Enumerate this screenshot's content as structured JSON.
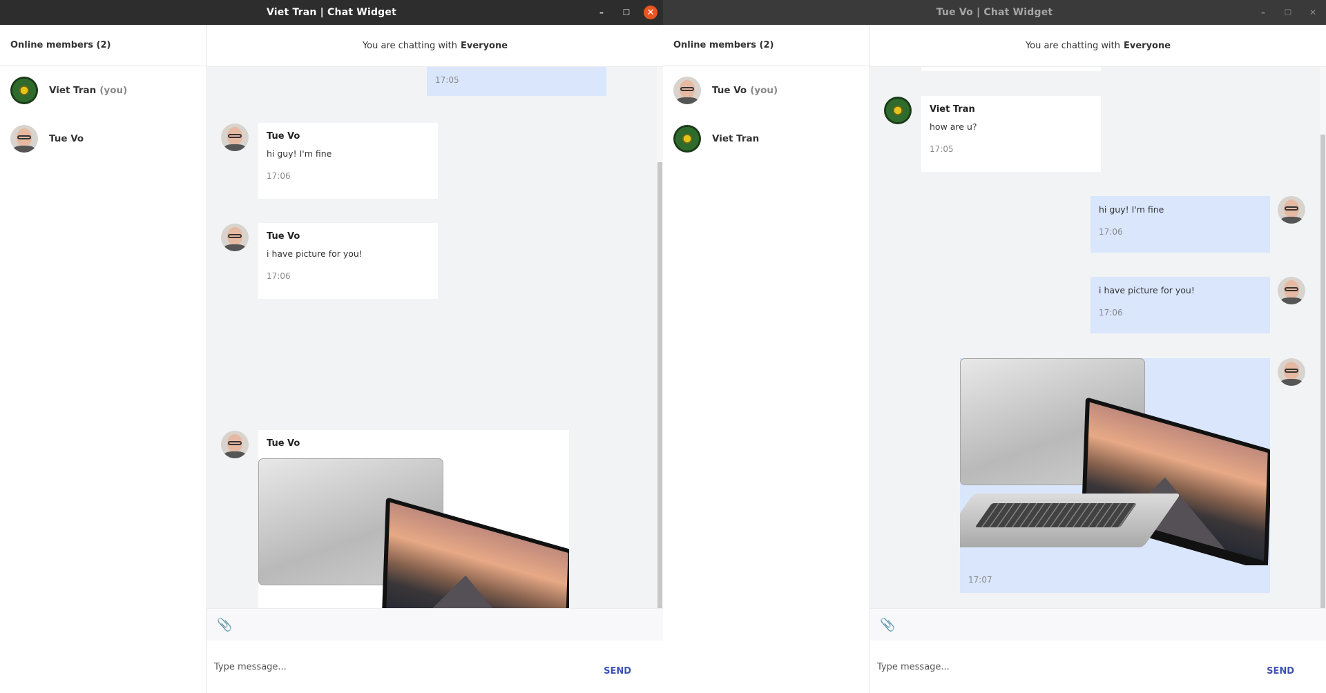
{
  "windows": [
    {
      "title": "Viet Tran | Chat Widget",
      "sidebar": {
        "heading": "Online members (2)",
        "members": [
          {
            "name": "Viet Tran",
            "suffix": "(you)"
          },
          {
            "name": "Tue Vo",
            "suffix": ""
          }
        ]
      },
      "chat": {
        "prefix": "You are chatting with",
        "target": "Everyone",
        "messages": [
          {
            "author": "",
            "text": "",
            "time": "17:05"
          },
          {
            "author": "Tue Vo",
            "text": "hi guy! I'm fine",
            "time": "17:06"
          },
          {
            "author": "Tue Vo",
            "text": "i have picture for you!",
            "time": "17:06"
          },
          {
            "author": "Tue Vo",
            "text": "",
            "time": ""
          }
        ],
        "input_placeholder": "Type message...",
        "send_label": "SEND"
      }
    },
    {
      "title": "Tue Vo | Chat Widget",
      "sidebar": {
        "heading": "Online members (2)",
        "members": [
          {
            "name": "Tue Vo",
            "suffix": "(you)"
          },
          {
            "name": "Viet Tran",
            "suffix": ""
          }
        ]
      },
      "chat": {
        "prefix": "You are chatting with",
        "target": "Everyone",
        "messages": [
          {
            "author": "Viet Tran",
            "text": "how are u?",
            "time": "17:05"
          },
          {
            "author": "",
            "text": "hi guy! I'm fine",
            "time": "17:06"
          },
          {
            "author": "",
            "text": "i have picture for you!",
            "time": "17:06"
          },
          {
            "author": "",
            "text": "",
            "time": "17:07"
          }
        ],
        "input_placeholder": "Type message...",
        "send_label": "SEND"
      }
    }
  ],
  "icons": {
    "minimize": "–",
    "maximize": "☐",
    "close": "✕",
    "attach": "📎"
  },
  "colors": {
    "accent_send": "#3f51b5",
    "own_bubble": "#d9e6fc",
    "close_active": "#e95420"
  }
}
